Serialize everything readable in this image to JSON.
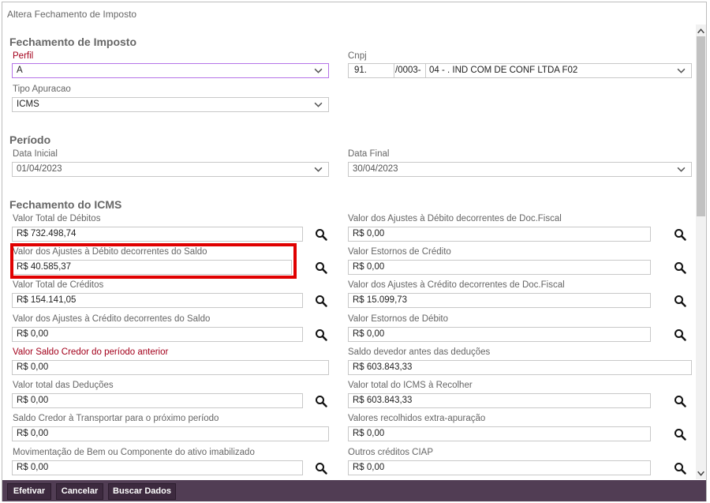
{
  "window": {
    "title": "Altera Fechamento de Imposto"
  },
  "sections": {
    "fechamento": "Fechamento de Imposto",
    "periodo": "Período",
    "icms": "Fechamento do ICMS"
  },
  "form": {
    "perfil": {
      "label": "Perfil",
      "value": "A"
    },
    "cnpj": {
      "label": "Cnpj",
      "part1": "91.",
      "part2": "/0003-",
      "filial": "04 - . IND COM DE CONF LTDA F02"
    },
    "tipo_apuracao": {
      "label": "Tipo Apuracao",
      "value": "ICMS"
    },
    "data_inicial": {
      "label": "Data Inicial",
      "value": "01/04/2023"
    },
    "data_final": {
      "label": "Data Final",
      "value": "30/04/2023"
    }
  },
  "icms_left": [
    {
      "label": "Valor Total de Débitos",
      "value": "R$ 732.498,74"
    },
    {
      "label": "Valor dos Ajustes à Débito decorrentes do Saldo",
      "value": "R$ 40.585,37"
    },
    {
      "label": "Valor Total de Créditos",
      "value": "R$ 154.141,05"
    },
    {
      "label": "Valor dos Ajustes à Crédito decorrentes do Saldo",
      "value": "R$ 0,00"
    },
    {
      "label": "Valor Saldo Credor do período anterior",
      "value": "R$ 0,00"
    },
    {
      "label": "Valor total das Deduções",
      "value": "R$ 0,00"
    },
    {
      "label": "Saldo Credor à Transportar para o próximo período",
      "value": "R$ 0,00"
    },
    {
      "label": "Movimentação de Bem ou Componente do ativo imabilizado",
      "value": "R$ 0,00"
    }
  ],
  "icms_right": [
    {
      "label": "Valor dos Ajustes à Débito decorrentes de Doc.Fiscal",
      "value": "R$ 0,00"
    },
    {
      "label": "Valor Estornos de Crédito",
      "value": "R$ 0,00"
    },
    {
      "label": "Valor dos Ajustes à Crédito decorrentes de Doc.Fiscal",
      "value": "R$ 15.099,73"
    },
    {
      "label": "Valor Estornos de Débito",
      "value": "R$ 0,00"
    },
    {
      "label": "Saldo devedor antes das deduções",
      "value": "R$ 603.843,33"
    },
    {
      "label": "Valor total do ICMS à Recolher",
      "value": "R$ 603.843,33"
    },
    {
      "label": "Valores recolhidos extra-apuração",
      "value": "R$ 0,00"
    },
    {
      "label": "Outros créditos CIAP",
      "value": "R$ 0,00"
    }
  ],
  "footer": {
    "efetivar": "Efetivar",
    "cancelar": "Cancelar",
    "buscar": "Buscar Dados"
  },
  "colors": {
    "footer_bg": "#513d54",
    "button_bg": "#3d2a3f",
    "required_label": "#a3001b",
    "highlight": "#e00000",
    "focus_border": "#b574e8"
  }
}
